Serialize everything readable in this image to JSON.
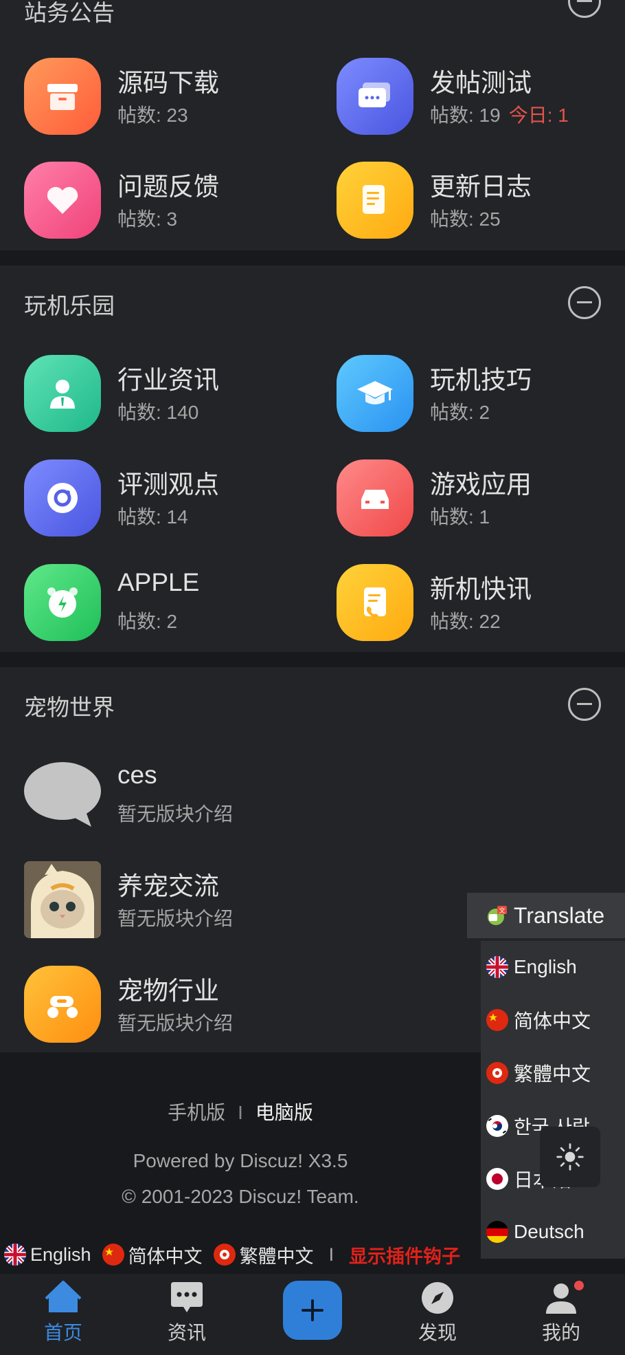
{
  "sections": [
    {
      "title": "站务公告",
      "forums": [
        {
          "name": "源码下载",
          "count": "帖数: 23",
          "today": ""
        },
        {
          "name": "发帖测试",
          "count": "帖数: 19",
          "today": "今日: 1"
        },
        {
          "name": "问题反馈",
          "count": "帖数: 3",
          "today": ""
        },
        {
          "name": "更新日志",
          "count": "帖数: 25",
          "today": ""
        }
      ]
    },
    {
      "title": "玩机乐园",
      "forums": [
        {
          "name": "行业资讯",
          "count": "帖数: 140"
        },
        {
          "name": "玩机技巧",
          "count": "帖数: 2"
        },
        {
          "name": "评测观点",
          "count": "帖数: 14"
        },
        {
          "name": "游戏应用",
          "count": "帖数: 1"
        },
        {
          "name": "APPLE",
          "count": "帖数: 2"
        },
        {
          "name": "新机快讯",
          "count": "帖数: 22"
        }
      ]
    },
    {
      "title": "宠物世界",
      "forums": [
        {
          "name": "ces",
          "desc": "暂无版块介绍"
        },
        {
          "name": "养宠交流",
          "desc": "暂无版块介绍"
        },
        {
          "name": "宠物行业",
          "desc": "暂无版块介绍"
        }
      ]
    }
  ],
  "footer": {
    "mobile": "手机版",
    "separator": "I",
    "desktop": "电脑版",
    "powered": "Powered by Discuz! X3.5",
    "copyright": "© 2001-2023 Discuz! Team."
  },
  "lang_bar": {
    "english": "English",
    "simplified": "简体中文",
    "traditional": "繁體中文",
    "separator": "I",
    "hooks": "显示插件钩子"
  },
  "translate": {
    "button": "Translate",
    "options": [
      "English",
      "简体中文",
      "繁體中文",
      "한국 사람",
      "日本語",
      "Deutsch"
    ]
  },
  "tabbar": {
    "home": "首页",
    "news": "资讯",
    "discover": "发现",
    "mine": "我的"
  },
  "colors": {
    "accent": "#2f7fd8",
    "today": "#e5534b",
    "hook": "#e0211a",
    "badge": "#e74c4c"
  }
}
